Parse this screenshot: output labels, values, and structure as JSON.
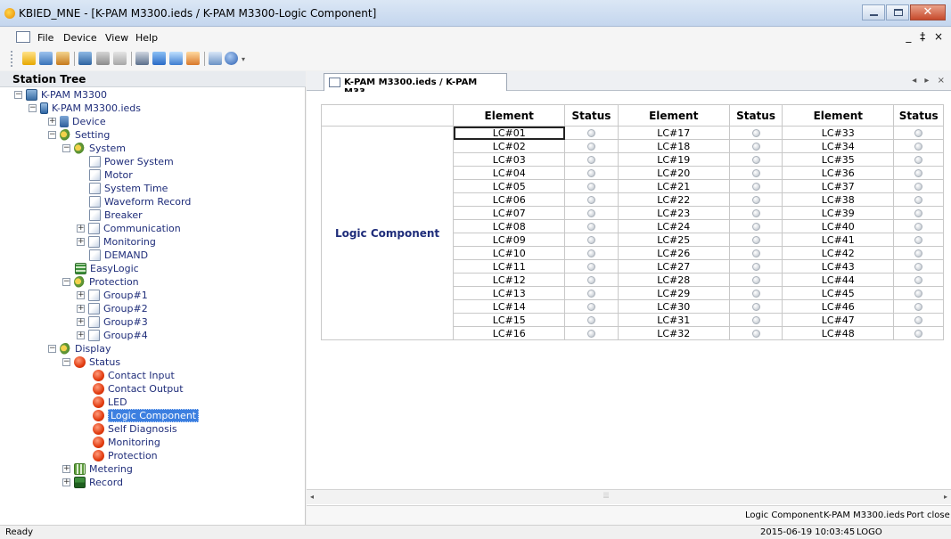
{
  "window": {
    "title": "KBIED_MNE - [K-PAM M3300.ieds / K-PAM M3300-Logic Component]",
    "mdi_controls": "_ ‡ ×"
  },
  "menu": [
    "File",
    "Device",
    "View",
    "Help"
  ],
  "toolbar_icons": [
    "open-folder-icon",
    "save-icon",
    "import-icon",
    "device-icon",
    "connect-icon",
    "disconnect-icon",
    "download-icon",
    "upload-icon",
    "monitor-icon",
    "settings-icon",
    "help-icon"
  ],
  "tree": {
    "header": "Station Tree",
    "nodes": [
      {
        "label": "K-PAM M3300",
        "icon": "station-icon"
      },
      {
        "label": "K-PAM M3300.ieds",
        "icon": "ied-icon"
      },
      {
        "label": "Device",
        "icon": "device-icon"
      },
      {
        "label": "Setting",
        "icon": "gear-icon"
      },
      {
        "label": "System",
        "icon": "gear-icon"
      },
      {
        "label": "Power System",
        "icon": "doc-icon"
      },
      {
        "label": "Motor",
        "icon": "doc-icon"
      },
      {
        "label": "System Time",
        "icon": "doc-icon"
      },
      {
        "label": "Waveform Record",
        "icon": "doc-icon"
      },
      {
        "label": "Breaker",
        "icon": "doc-icon"
      },
      {
        "label": "Communication",
        "icon": "doc-icon"
      },
      {
        "label": "Monitoring",
        "icon": "doc-icon"
      },
      {
        "label": "DEMAND",
        "icon": "doc-icon"
      },
      {
        "label": "EasyLogic",
        "icon": "grid-icon"
      },
      {
        "label": "Protection",
        "icon": "gear-icon"
      },
      {
        "label": "Group#1",
        "icon": "doc-icon"
      },
      {
        "label": "Group#2",
        "icon": "doc-icon"
      },
      {
        "label": "Group#3",
        "icon": "doc-icon"
      },
      {
        "label": "Group#4",
        "icon": "doc-icon"
      },
      {
        "label": "Display",
        "icon": "gear-icon"
      },
      {
        "label": "Status",
        "icon": "status-icon"
      },
      {
        "label": "Contact Input",
        "icon": "status-icon"
      },
      {
        "label": "Contact Output",
        "icon": "status-icon"
      },
      {
        "label": "LED",
        "icon": "status-icon"
      },
      {
        "label": "Logic Component",
        "icon": "status-icon"
      },
      {
        "label": "Self Diagnosis",
        "icon": "status-icon"
      },
      {
        "label": "Monitoring",
        "icon": "status-icon"
      },
      {
        "label": "Protection",
        "icon": "status-icon"
      },
      {
        "label": "Metering",
        "icon": "meter-icon"
      },
      {
        "label": "Record",
        "icon": "record-icon"
      }
    ]
  },
  "doc_tab": {
    "label": "K-PAM M3300.ieds / K-PAM M33...",
    "nav": "◂ ▸ ×"
  },
  "logic_table": {
    "row_label": "Logic Component",
    "headers": [
      "Element",
      "Status",
      "Element",
      "Status",
      "Element",
      "Status"
    ],
    "rows": [
      [
        "LC#01",
        "LC#17",
        "LC#33"
      ],
      [
        "LC#02",
        "LC#18",
        "LC#34"
      ],
      [
        "LC#03",
        "LC#19",
        "LC#35"
      ],
      [
        "LC#04",
        "LC#20",
        "LC#36"
      ],
      [
        "LC#05",
        "LC#21",
        "LC#37"
      ],
      [
        "LC#06",
        "LC#22",
        "LC#38"
      ],
      [
        "LC#07",
        "LC#23",
        "LC#39"
      ],
      [
        "LC#08",
        "LC#24",
        "LC#40"
      ],
      [
        "LC#09",
        "LC#25",
        "LC#41"
      ],
      [
        "LC#10",
        "LC#26",
        "LC#42"
      ],
      [
        "LC#11",
        "LC#27",
        "LC#43"
      ],
      [
        "LC#12",
        "LC#28",
        "LC#44"
      ],
      [
        "LC#13",
        "LC#29",
        "LC#45"
      ],
      [
        "LC#14",
        "LC#30",
        "LC#46"
      ],
      [
        "LC#15",
        "LC#31",
        "LC#47"
      ],
      [
        "LC#16",
        "LC#32",
        "LC#48"
      ]
    ]
  },
  "doc_status": {
    "view": "Logic Component",
    "file": "K-PAM M3300.ieds",
    "port": "Port close"
  },
  "status_bar": {
    "state": "Ready",
    "datetime": "2015-06-19 10:03:45",
    "mode": "LOGO"
  }
}
